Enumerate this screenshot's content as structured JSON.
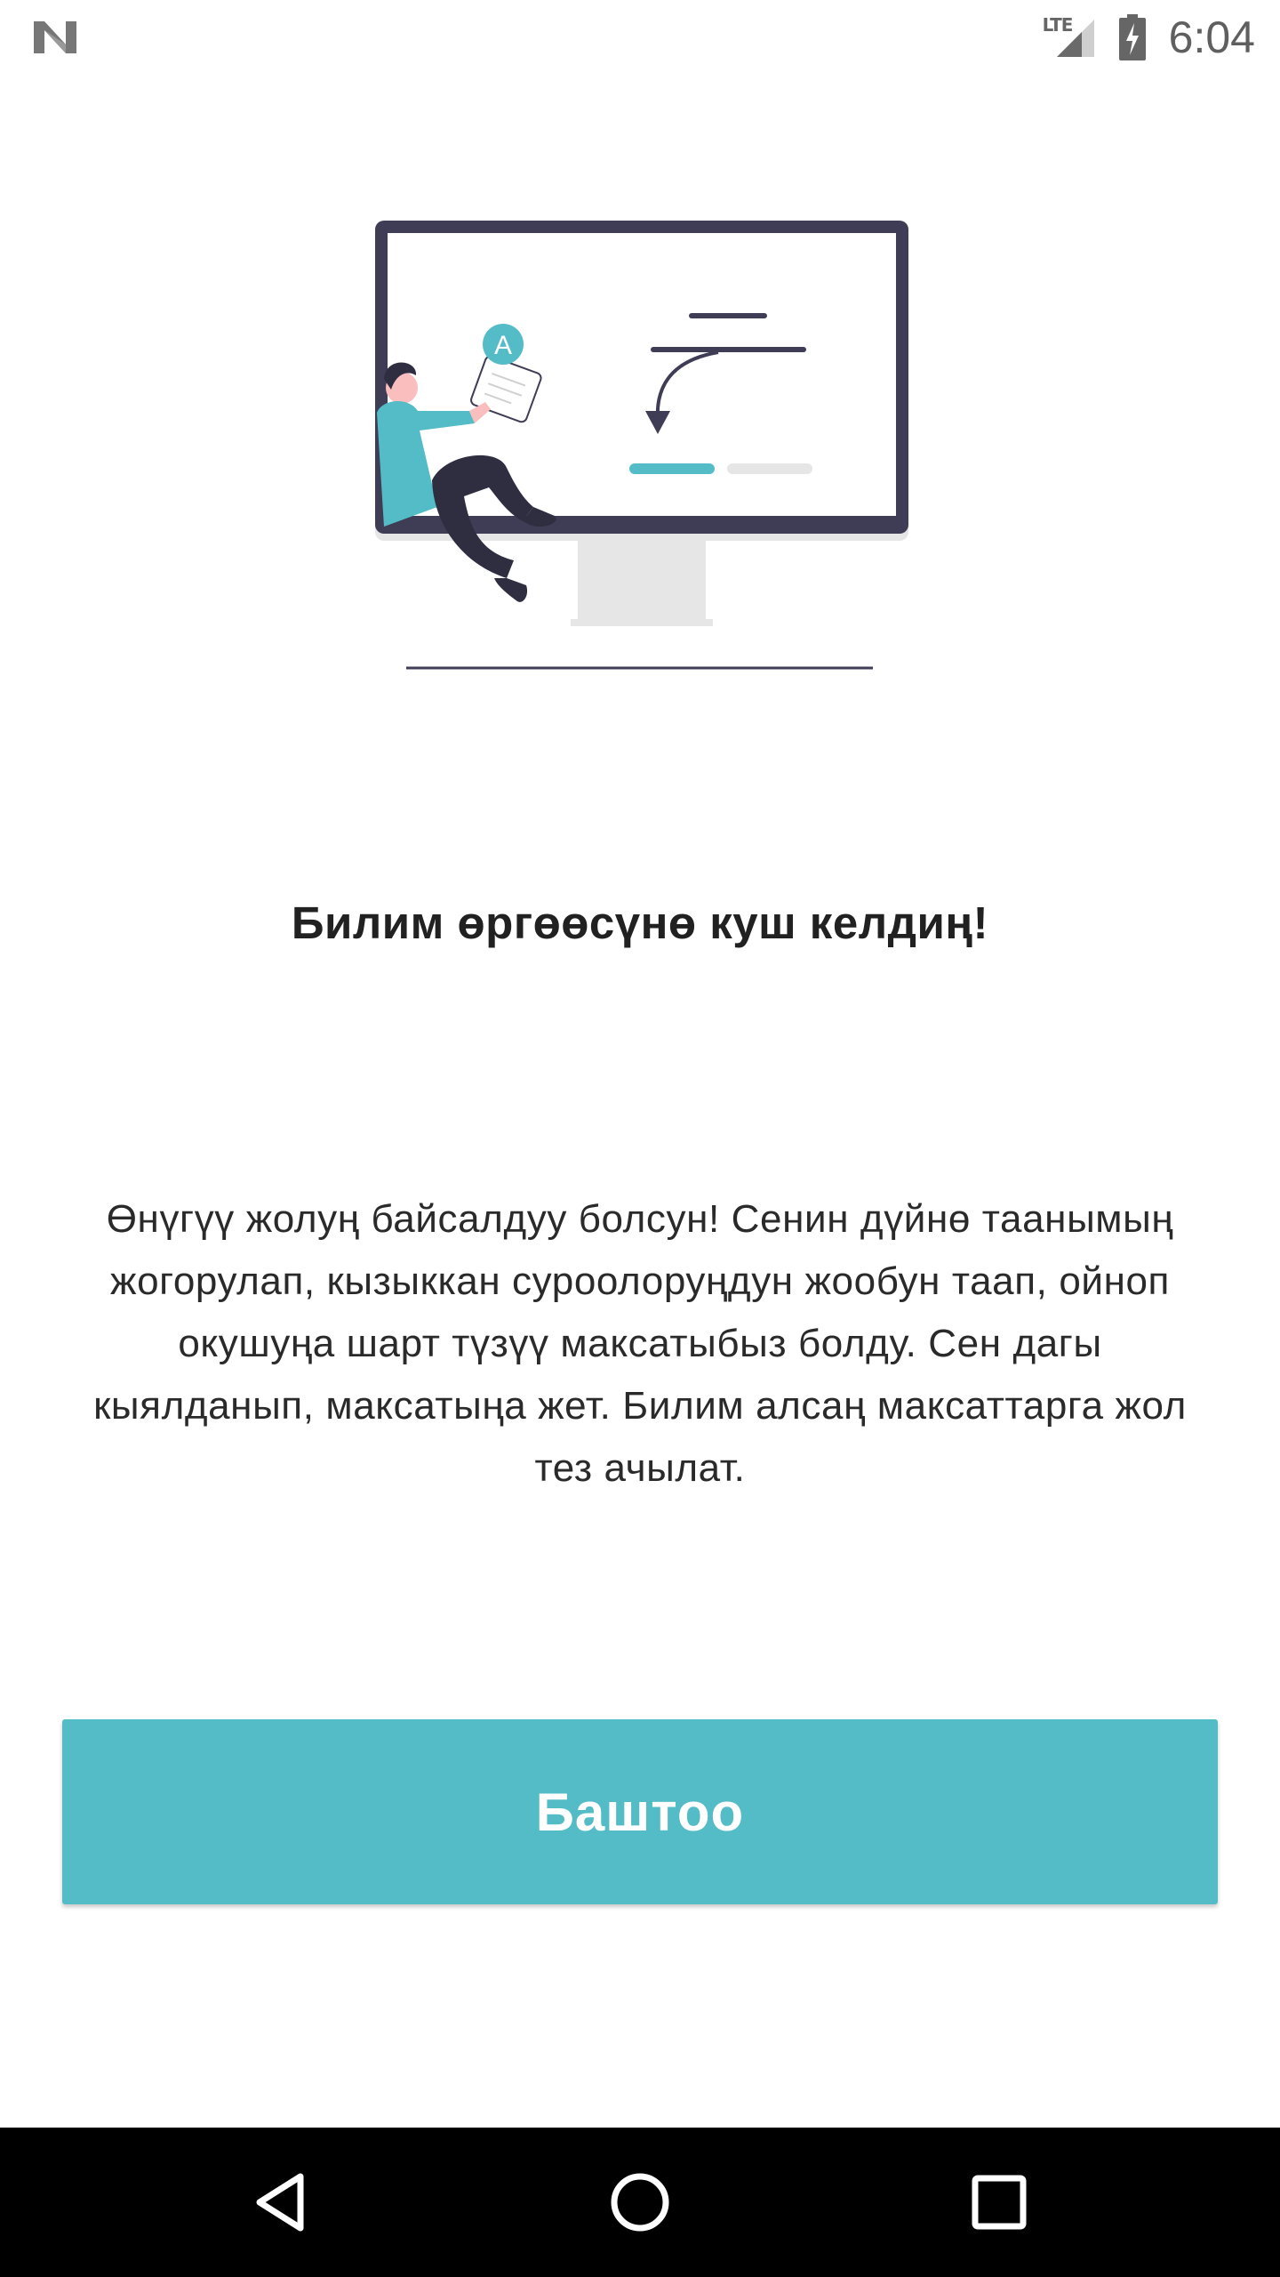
{
  "status_bar": {
    "network_label": "LTE",
    "time": "6:04",
    "left_icon": "n-notification-icon",
    "signal_icon": "cell-signal-icon",
    "battery_icon": "battery-charging-icon"
  },
  "illustration": {
    "icon": "person-at-monitor-illustration",
    "badge_letter": "A"
  },
  "welcome": {
    "title": "Билим өргөөсүнө куш келдиң!",
    "body": "Өнүгүү жолуң байсалдуу болсун! Сенин дүйнө таанымың жогорулап, кызыккан суроолоруңдун жообун таап, ойноп окушуңа шарт түзүү максатыбыз болду. Сен дагы кыялданып, максатыңа жет. Билим алсаң максаттарга жол тез ачылат."
  },
  "actions": {
    "start_label": "Баштоо"
  },
  "nav_bar": {
    "back_icon": "back-icon",
    "home_icon": "home-icon",
    "recents_icon": "recents-icon"
  },
  "colors": {
    "accent": "#53bcc7",
    "monitor_frame": "#3f3d56",
    "monitor_stand": "#e6e6e6",
    "text_primary": "#212121",
    "nav_background": "#000000"
  }
}
